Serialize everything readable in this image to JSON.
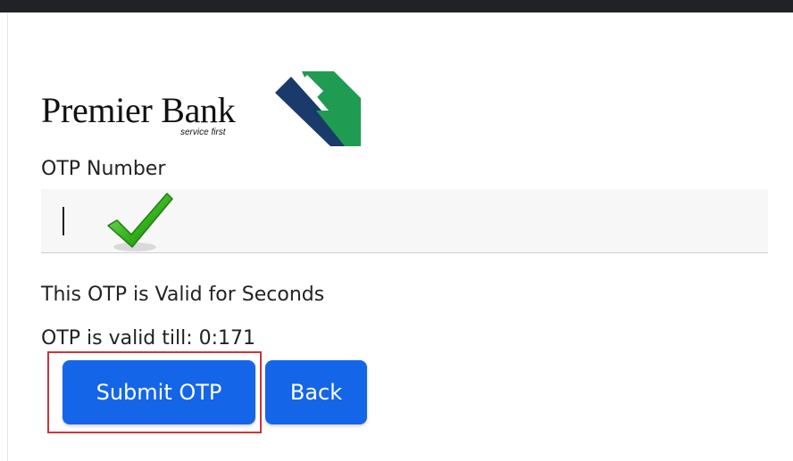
{
  "brand": {
    "name": "Premier Bank",
    "tagline": "service first",
    "colors": {
      "navy": "#1a3a6b",
      "green": "#1f9b52",
      "button": "#1565e8",
      "highlight": "#c9353b"
    }
  },
  "form": {
    "otp_label": "OTP Number",
    "otp_value": "",
    "status_icon": "checkmark-icon"
  },
  "info": {
    "valid_for": "This OTP is Valid for Seconds",
    "valid_till": "OTP is valid till: 0:171"
  },
  "actions": {
    "submit_label": "Submit OTP",
    "back_label": "Back"
  }
}
